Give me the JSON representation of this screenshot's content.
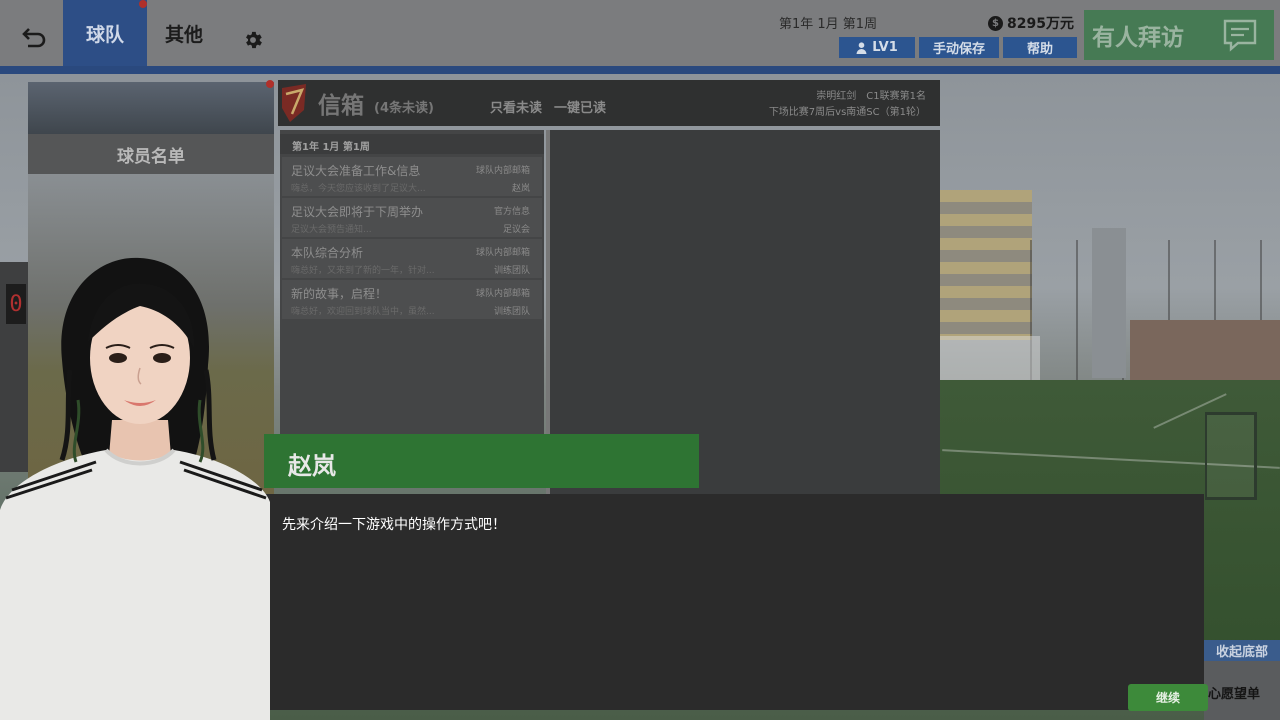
{
  "topbar": {
    "tabs": [
      {
        "label": "球队",
        "active": true
      },
      {
        "label": "其他",
        "active": false
      }
    ],
    "date": "第1年 1月 第1周",
    "money": "8295万元",
    "level_button": "LV1",
    "save_button": "手动保存",
    "help_button": "帮助",
    "visit_button": "有人拜访"
  },
  "roster": {
    "title": "球员名单",
    "scoreboard": "0"
  },
  "inbox": {
    "title": "信箱",
    "unread_count": "(4条未读)",
    "filter_unread": "只看未读",
    "mark_all_read": "一键已读",
    "club_line1": "崇明红剑　C1联赛第1名",
    "club_line2": "下场比赛7周后vs南通SC（第1轮）",
    "list_date": "第1年 1月 第1周",
    "mails": [
      {
        "subject": "足议大会准备工作&信息",
        "preview": "嗨总，今天您应该收到了足议大...",
        "source": "球队内部邮箱",
        "sender": "赵岚"
      },
      {
        "subject": "足议大会即将于下周举办",
        "preview": "足议大会预告通知...",
        "source": "官方信息",
        "sender": "足议会"
      },
      {
        "subject": "本队综合分析",
        "preview": "嗨总好，又来到了新的一年，针对...",
        "source": "球队内部邮箱",
        "sender": "训练团队"
      },
      {
        "subject": "新的故事，启程！",
        "preview": "嗨总好，欢迎回到球队当中，虽然...",
        "source": "球队内部邮箱",
        "sender": "训练团队"
      }
    ]
  },
  "dialog": {
    "speaker": "赵岚",
    "text": "先来介绍一下游戏中的操作方式吧！",
    "continue_button": "继续"
  },
  "bottom": {
    "collapse_button": "收起底部",
    "wish_list": "心愿望单"
  },
  "colors": {
    "nav_active": "#2d4e86",
    "accent_blue": "#2c5590",
    "accent_green": "#2e7433",
    "notification_red": "#b0302a"
  }
}
